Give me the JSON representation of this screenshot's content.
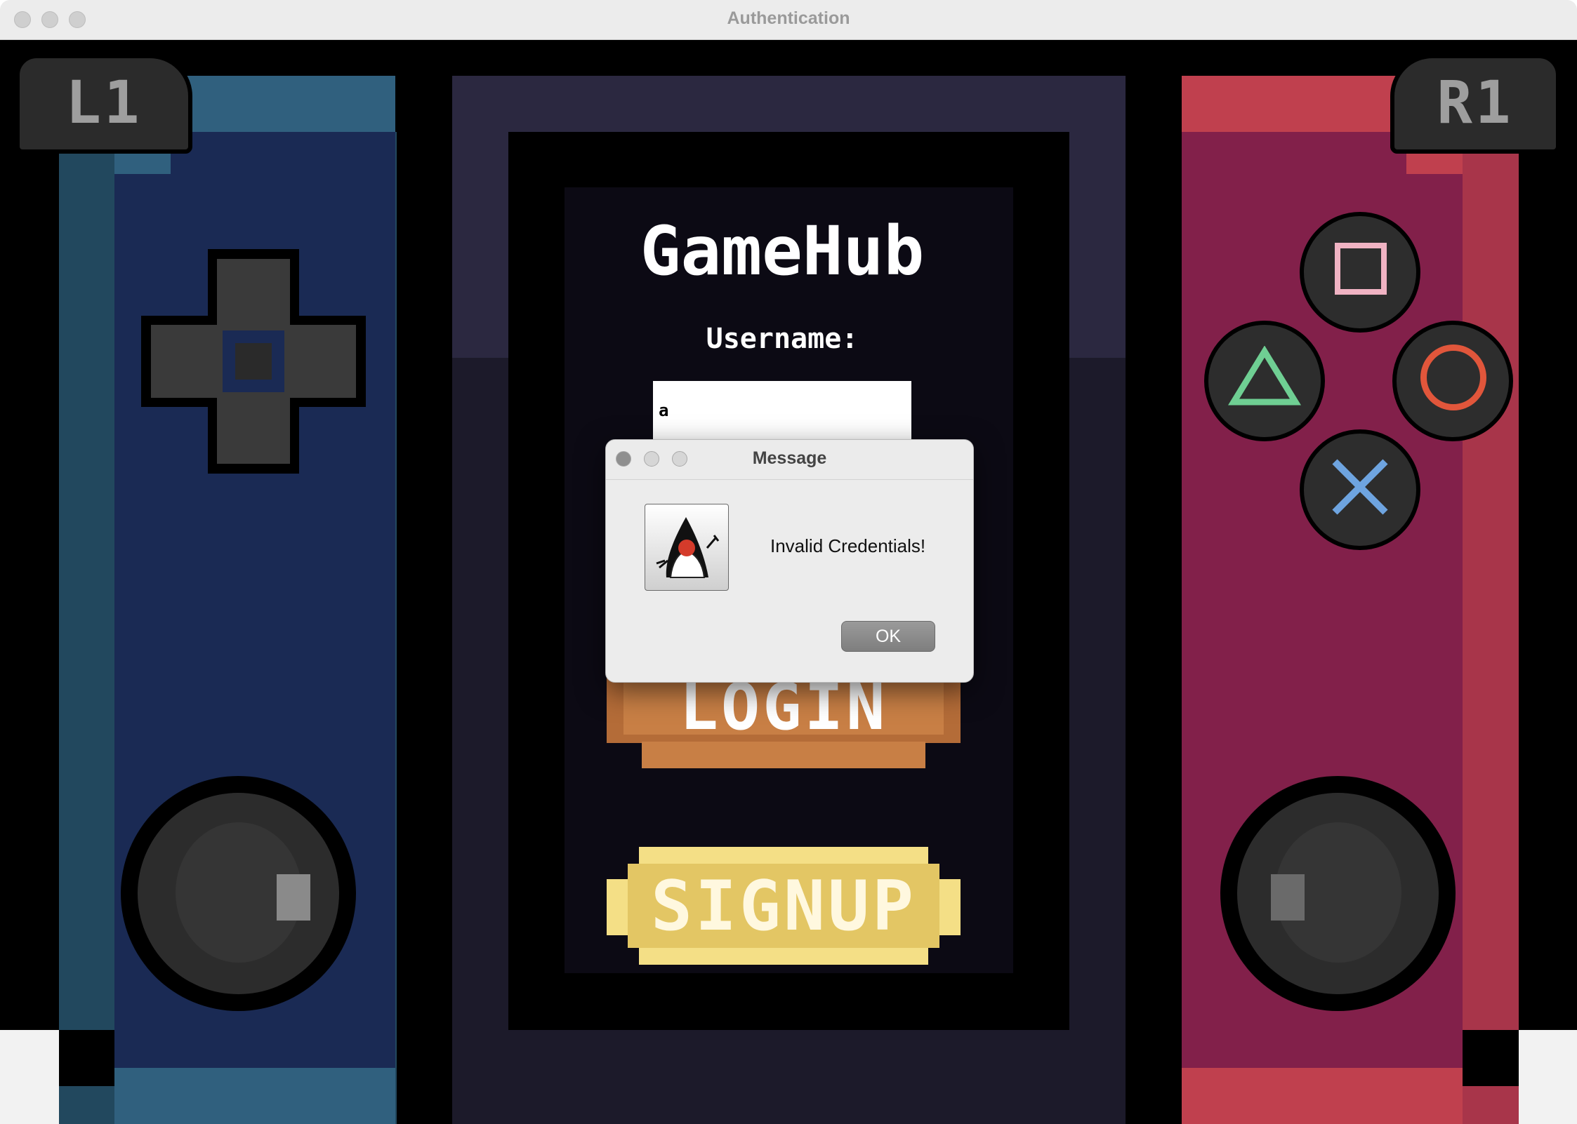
{
  "window": {
    "title": "Authentication"
  },
  "app": {
    "title": "GameHub",
    "username_label": "Username:",
    "username_value": "a",
    "login_label": "LOGIN",
    "signup_label": "SIGNUP",
    "left_shoulder": "L1",
    "right_shoulder": "R1"
  },
  "dialog": {
    "title": "Message",
    "message": "Invalid Credentials!",
    "ok_label": "OK",
    "icon": "java-duke-icon"
  },
  "colors": {
    "left_panel": "#1a2a54",
    "left_panel_light": "#30607e",
    "center_frame": "#2b2840",
    "screen": "#0c0a14",
    "right_panel": "#82204a",
    "right_panel_light": "#c0404e",
    "login_button": "#c87f45",
    "signup_button": "#e8cf70",
    "face_triangle": "#6fcf93",
    "face_circle": "#e1563b",
    "face_cross": "#6ea4e0",
    "face_square": "#f0b3c3"
  }
}
